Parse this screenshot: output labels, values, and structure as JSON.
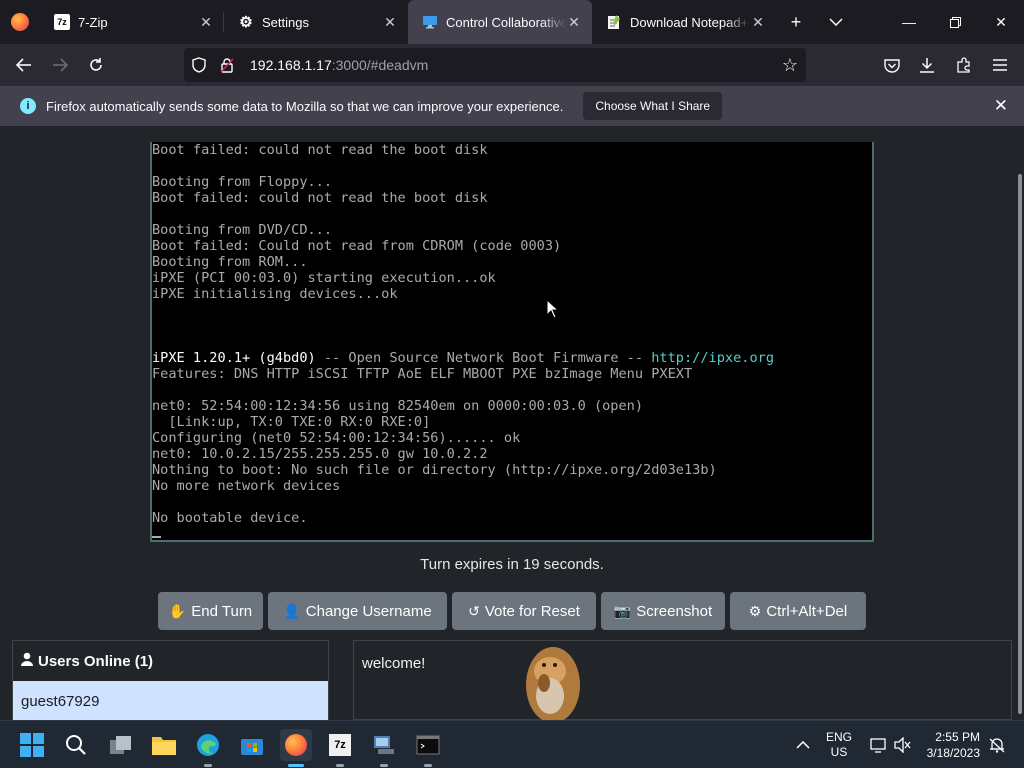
{
  "browser": {
    "tabs": [
      {
        "label": "7-Zip",
        "icon": "7zip-icon"
      },
      {
        "label": "Settings",
        "icon": "gear-icon"
      },
      {
        "label": "Control Collaborative V",
        "icon": "monitor-icon"
      },
      {
        "label": "Download Notepad++",
        "icon": "notepad-icon"
      }
    ],
    "url_host": "192.168.1.17",
    "url_rest": ":3000/#deadvm"
  },
  "notification": {
    "text": "Firefox automatically sends some data to Mozilla so that we can improve your experience.",
    "button": "Choose What I Share"
  },
  "terminal": {
    "lines": [
      "Boot failed: could not read the boot disk",
      "",
      "Booting from Floppy...",
      "Boot failed: could not read the boot disk",
      "",
      "Booting from DVD/CD...",
      "Boot failed: Could not read from CDROM (code 0003)",
      "Booting from ROM...",
      "iPXE (PCI 00:03.0) starting execution...ok",
      "iPXE initialising devices...ok",
      "",
      "",
      "",
      "Features: DNS HTTP iSCSI TFTP AoE ELF MBOOT PXE bzImage Menu PXEXT",
      "",
      "net0: 52:54:00:12:34:56 using 82540em on 0000:00:03.0 (open)",
      "  [Link:up, TX:0 TXE:0 RX:0 RXE:0]",
      "Configuring (net0 52:54:00:12:34:56)...... ok",
      "net0: 10.0.2.15/255.255.255.0 gw 10.0.2.2",
      "Nothing to boot: No such file or directory (http://ipxe.org/2d03e13b)",
      "No more network devices",
      "",
      "No bootable device."
    ],
    "ipxe_version": "iPXE 1.20.1+ (g4bd0)",
    "ipxe_tagline": " -- Open Source Network Boot Firmware -- ",
    "ipxe_link": "http://ipxe.org"
  },
  "turn_text": "Turn expires in 19 seconds.",
  "buttons": {
    "end_turn": "End Turn",
    "change_username": "Change Username",
    "vote_reset": "Vote for Reset",
    "screenshot": "Screenshot",
    "ctrl_alt_del": "Ctrl+Alt+Del"
  },
  "users": {
    "heading": "Users Online (1)",
    "list": [
      "guest67929"
    ]
  },
  "chat": {
    "message": "welcome!"
  },
  "taskbar": {
    "lang_top": "ENG",
    "lang_bottom": "US",
    "time": "2:55 PM",
    "date": "3/18/2023"
  },
  "colors": {
    "accent": "#4cc2ff",
    "button": "#6c757d",
    "terminal_link": "#55cccc"
  }
}
